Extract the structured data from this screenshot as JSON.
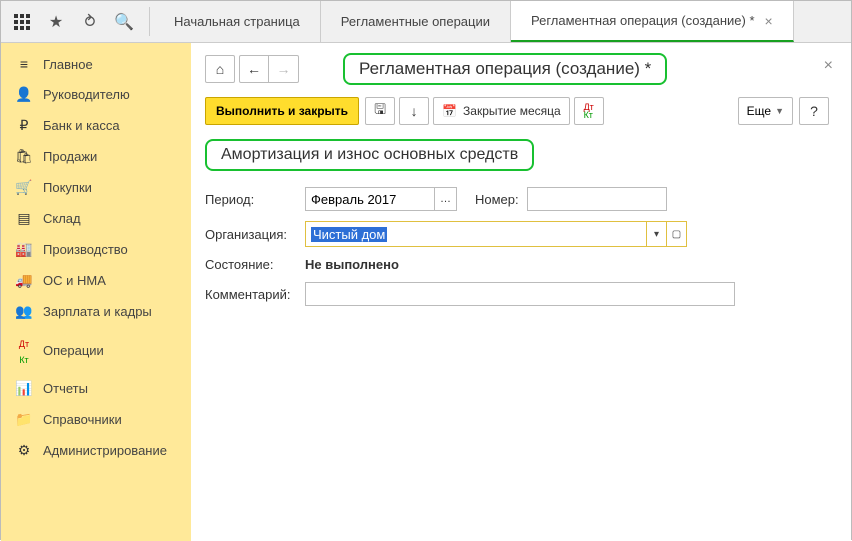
{
  "topbar": {
    "tabs": [
      {
        "label": "Начальная страница",
        "active": false
      },
      {
        "label": "Регламентные операции",
        "active": false
      },
      {
        "label": "Регламентная операция (создание) *",
        "active": true
      }
    ]
  },
  "sidebar": {
    "items": [
      {
        "icon": "≡",
        "label": "Главное"
      },
      {
        "icon": "👤",
        "label": "Руководителю"
      },
      {
        "icon": "₽",
        "label": "Банк и касса"
      },
      {
        "icon": "🛍",
        "label": "Продажи"
      },
      {
        "icon": "🛒",
        "label": "Покупки"
      },
      {
        "icon": "▤",
        "label": "Склад"
      },
      {
        "icon": "🏭",
        "label": "Производство"
      },
      {
        "icon": "🚚",
        "label": "ОС и НМА"
      },
      {
        "icon": "👥",
        "label": "Зарплата и кадры"
      },
      {
        "icon": "Дт",
        "label": "Операции"
      },
      {
        "icon": "📊",
        "label": "Отчеты"
      },
      {
        "icon": "📁",
        "label": "Справочники"
      },
      {
        "icon": "⚙",
        "label": "Администрирование"
      }
    ]
  },
  "header": {
    "title": "Регламентная операция (создание) *"
  },
  "toolbar": {
    "execute_close": "Выполнить и закрыть",
    "close_month": "Закрытие месяца",
    "more": "Еще",
    "help": "?"
  },
  "subtitle": "Амортизация и износ основных средств",
  "form": {
    "period_label": "Период:",
    "period_value": "Февраль 2017",
    "number_label": "Номер:",
    "number_value": "",
    "org_label": "Организация:",
    "org_value": "Чистый дом",
    "state_label": "Состояние:",
    "state_value": "Не выполнено",
    "comment_label": "Комментарий:",
    "comment_value": ""
  }
}
